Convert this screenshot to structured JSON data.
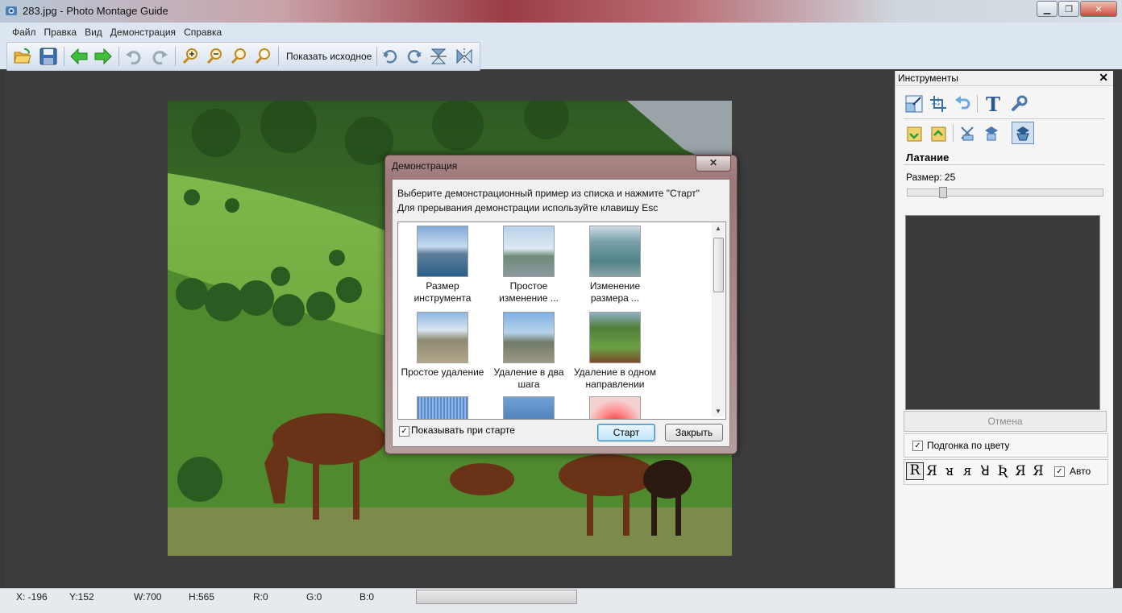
{
  "window": {
    "title": "283.jpg - Photo Montage Guide",
    "icon": "app-icon"
  },
  "menu": [
    "Файл",
    "Правка",
    "Вид",
    "Демонстрация",
    "Справка"
  ],
  "toolbar": {
    "show_original_label": "Показать исходное",
    "icons": [
      "open-folder-icon",
      "save-icon",
      "back-arrow-icon",
      "forward-arrow-icon",
      "undo-icon",
      "redo-icon",
      "zoom-in-icon",
      "zoom-out-icon",
      "zoom-fit-icon",
      "zoom-actual-icon",
      "rotate-cw-icon",
      "rotate-ccw-icon",
      "flip-vertical-icon",
      "flip-horizontal-icon"
    ]
  },
  "panel": {
    "title": "Инструменты",
    "close_glyph": "✕",
    "tool_name": "Латание",
    "size_label": "Размер: 25",
    "size_value": 25,
    "cancel_label": "Отмена",
    "color_match_label": "Подгонка по цвету",
    "color_match_checked": true,
    "auto_label": "Авто",
    "auto_checked": true,
    "modes": [
      "R",
      "Я",
      "ᴚ",
      "ᴙ",
      "ꓤ",
      "Ʀ",
      "Я",
      "Я"
    ]
  },
  "dialog": {
    "title": "Демонстрация",
    "close_glyph": "✕",
    "line1": "Выберите демонстрационный пример из списка и нажмите \"Старт\"",
    "line2": "Для прерывания демонстрации используйте клавишу Esc",
    "items": [
      {
        "label1": "Размер",
        "label2": "инструмента"
      },
      {
        "label1": "Простое",
        "label2": "изменение ..."
      },
      {
        "label1": "Изменение",
        "label2": "размера ..."
      },
      {
        "label1": "Простое удаление",
        "label2": ""
      },
      {
        "label1": "Удаление в два",
        "label2": "шага"
      },
      {
        "label1": "Удаление в одном",
        "label2": "направлении"
      }
    ],
    "show_on_start_label": "Показывать при старте",
    "show_on_start_checked": true,
    "start_label": "Старт",
    "close_label": "Закрыть"
  },
  "status": {
    "x": "X: -196",
    "y": "Y:152",
    "w": "W:700",
    "h": "H:565",
    "r": "R:0",
    "g": "G:0",
    "b": "B:0"
  }
}
